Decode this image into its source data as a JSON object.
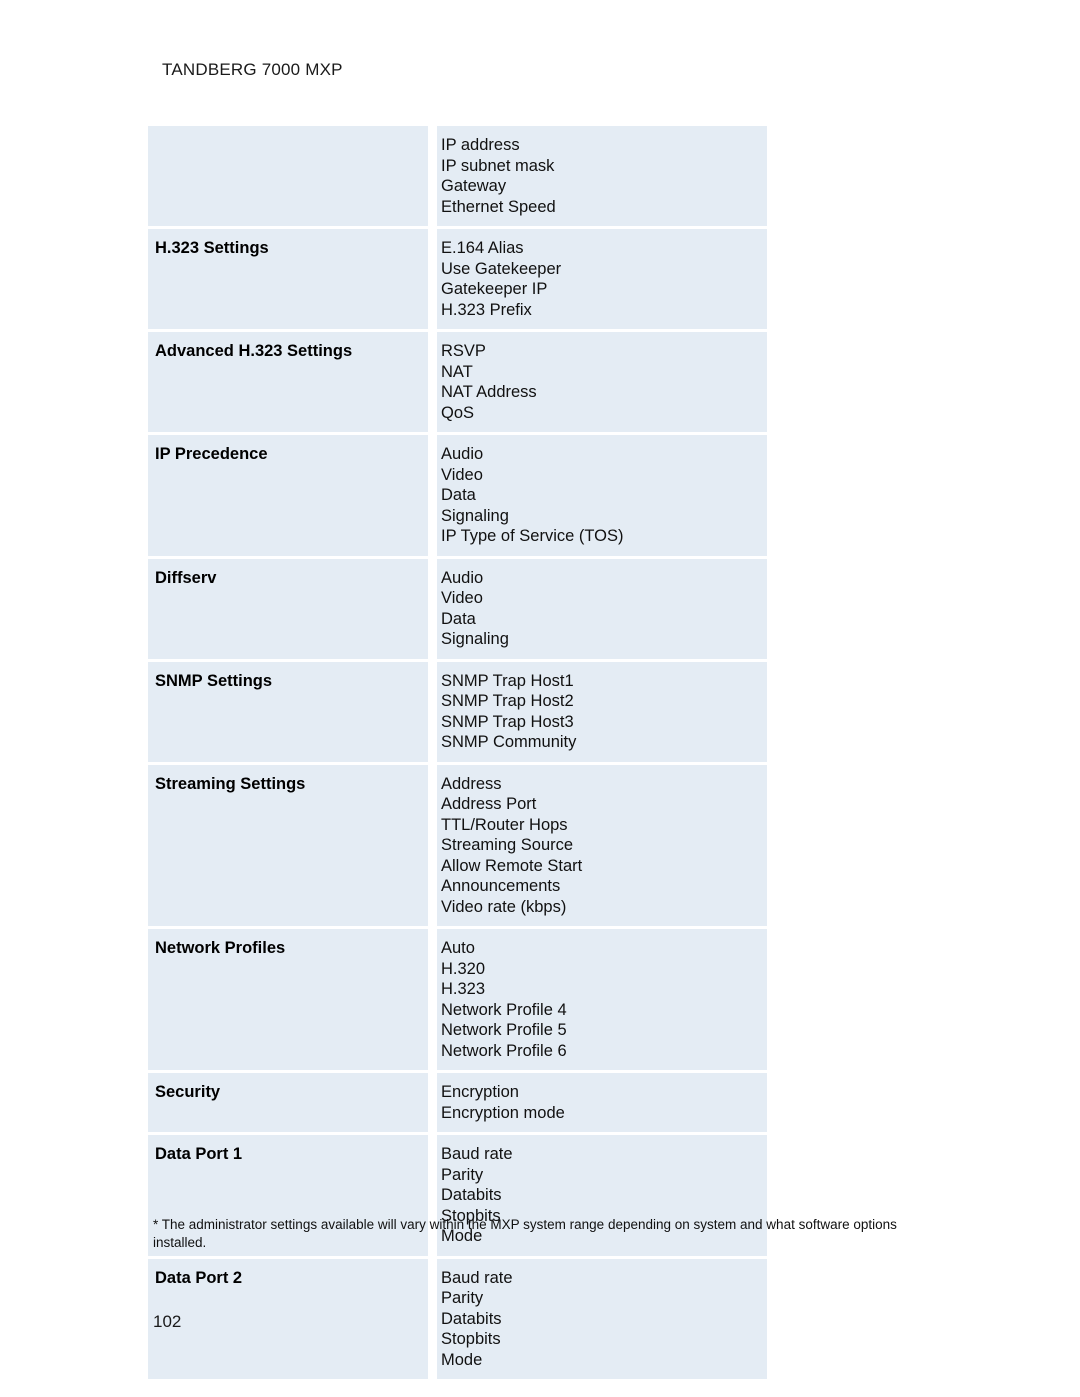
{
  "document": {
    "running_head": "TANDBERG 7000 MXP",
    "page_number": "102",
    "footnote": "* The administrator settings available will vary within the MXP system range depending on system and what software options installed.",
    "colors": {
      "cell_background": "#e4ecf4",
      "page_background": "#ffffff",
      "text": "#000000"
    }
  },
  "table": {
    "rows": [
      {
        "label": "",
        "items": [
          "IP address",
          "IP subnet mask",
          "Gateway",
          "Ethernet Speed"
        ]
      },
      {
        "label": "H.323 Settings",
        "items": [
          "E.164 Alias",
          "Use Gatekeeper",
          "Gatekeeper IP",
          "H.323 Prefix"
        ]
      },
      {
        "label": "Advanced H.323 Settings",
        "items": [
          "RSVP",
          "NAT",
          "NAT Address",
          "QoS"
        ]
      },
      {
        "label": "IP Precedence",
        "items": [
          "Audio",
          "Video",
          "Data",
          "Signaling",
          "IP Type of Service (TOS)"
        ]
      },
      {
        "label": "Diffserv",
        "items": [
          "Audio",
          "Video",
          "Data",
          "Signaling"
        ]
      },
      {
        "label": "SNMP Settings",
        "items": [
          "SNMP Trap Host1",
          "SNMP Trap Host2",
          "SNMP Trap Host3",
          "SNMP Community"
        ]
      },
      {
        "label": "Streaming Settings",
        "items": [
          "Address",
          "Address Port",
          "TTL/Router Hops",
          "Streaming Source",
          "Allow Remote Start",
          "Announcements",
          "Video rate (kbps)"
        ]
      },
      {
        "label": "Network Profiles",
        "items": [
          "Auto",
          "H.320",
          "H.323",
          "Network Profile 4",
          "Network Profile 5",
          "Network Profile 6"
        ]
      },
      {
        "label": "Security",
        "items": [
          "Encryption",
          "Encryption mode"
        ]
      },
      {
        "label": "Data Port 1",
        "items": [
          "Baud rate",
          "Parity",
          "Databits",
          "Stopbits",
          "Mode"
        ]
      },
      {
        "label": "Data Port 2",
        "items": [
          "Baud rate",
          "Parity",
          "Databits",
          "Stopbits",
          "Mode"
        ]
      }
    ]
  }
}
